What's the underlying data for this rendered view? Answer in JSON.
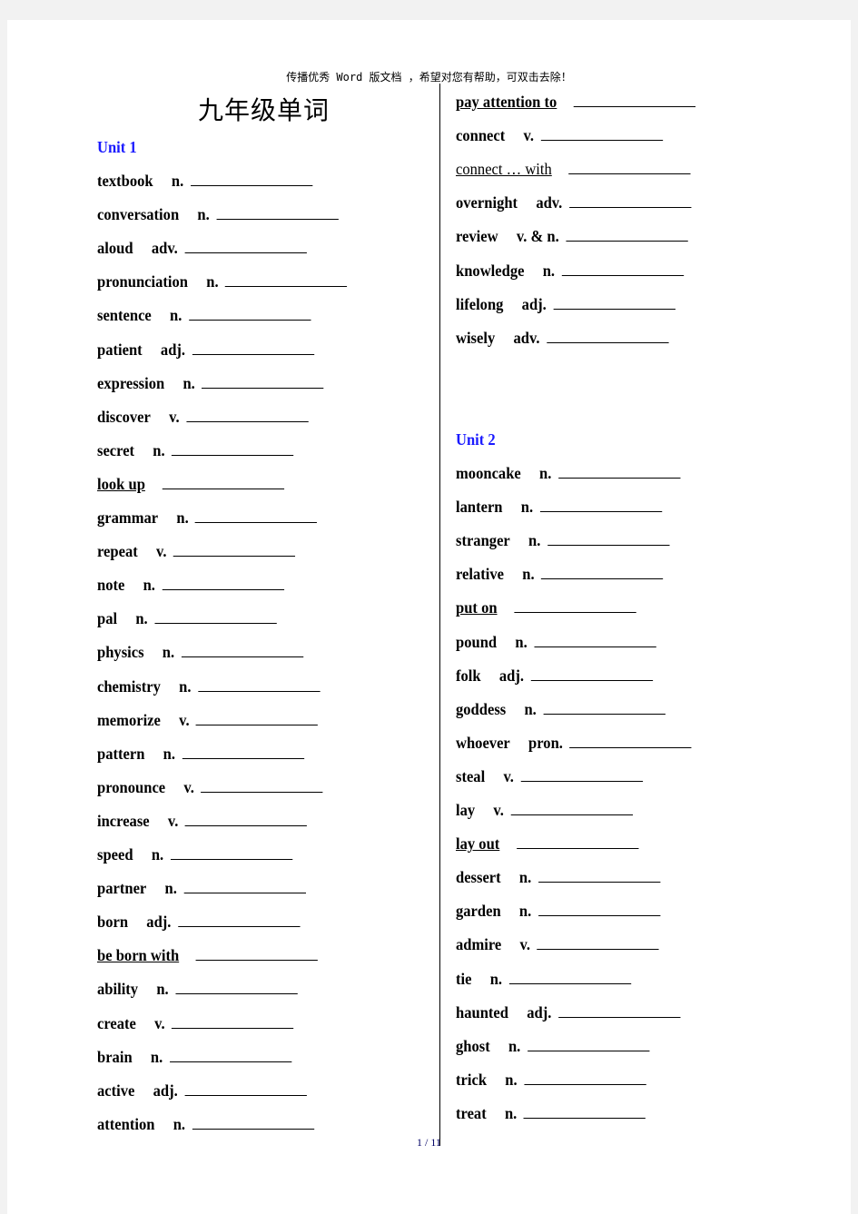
{
  "header_notice": "传播优秀 Word 版文档 ，希望对您有帮助，可双击去除！",
  "title": "九年级单词",
  "footer": "1 / 11",
  "colors": {
    "unit_heading": "#1a1aff"
  },
  "left_column": {
    "unit_heading": "Unit 1",
    "entries": [
      {
        "word": "textbook",
        "pos": "n."
      },
      {
        "word": "conversation",
        "pos": "n."
      },
      {
        "word": "aloud",
        "pos": "adv."
      },
      {
        "word": "pronunciation",
        "pos": "n."
      },
      {
        "word": "sentence",
        "pos": "n."
      },
      {
        "word": "patient",
        "pos": "adj."
      },
      {
        "word": "expression",
        "pos": "n."
      },
      {
        "word": "discover",
        "pos": "v."
      },
      {
        "word": "secret",
        "pos": "n."
      },
      {
        "word": "look up",
        "pos": "",
        "underlined": true
      },
      {
        "word": "grammar",
        "pos": "n."
      },
      {
        "word": "repeat",
        "pos": "v."
      },
      {
        "word": "note",
        "pos": "n."
      },
      {
        "word": "pal",
        "pos": "n."
      },
      {
        "word": "physics",
        "pos": "n."
      },
      {
        "word": "chemistry",
        "pos": "n."
      },
      {
        "word": "memorize",
        "pos": "v."
      },
      {
        "word": "pattern",
        "pos": "n."
      },
      {
        "word": "pronounce",
        "pos": "v."
      },
      {
        "word": "increase",
        "pos": "v."
      },
      {
        "word": "speed",
        "pos": "n."
      },
      {
        "word": "partner",
        "pos": "n."
      },
      {
        "word": "born",
        "pos": "adj."
      },
      {
        "word": "be born with",
        "pos": "",
        "underlined": true
      },
      {
        "word": "ability",
        "pos": "n."
      },
      {
        "word": "create",
        "pos": "v."
      },
      {
        "word": "brain",
        "pos": "n."
      },
      {
        "word": "active",
        "pos": "adj."
      },
      {
        "word": "attention",
        "pos": "n."
      }
    ]
  },
  "right_column": {
    "entries_top": [
      {
        "word": "pay attention to",
        "pos": "",
        "underlined": true
      },
      {
        "word": "connect",
        "pos": "v."
      },
      {
        "word": "connect … with",
        "pos": "",
        "underlined": true,
        "plain": true
      },
      {
        "word": "overnight",
        "pos": "adv."
      },
      {
        "word": "review",
        "pos": "v. & n."
      },
      {
        "word": "knowledge",
        "pos": "n."
      },
      {
        "word": "lifelong",
        "pos": "adj."
      },
      {
        "word": "wisely",
        "pos": "adv."
      }
    ],
    "unit_heading": "Unit 2",
    "entries": [
      {
        "word": "mooncake",
        "pos": "n."
      },
      {
        "word": "lantern",
        "pos": "n."
      },
      {
        "word": "stranger",
        "pos": "n."
      },
      {
        "word": "relative",
        "pos": "n."
      },
      {
        "word": "put on",
        "pos": "",
        "underlined": true
      },
      {
        "word": "pound",
        "pos": "n."
      },
      {
        "word": "folk",
        "pos": "adj."
      },
      {
        "word": "goddess",
        "pos": "n."
      },
      {
        "word": "whoever",
        "pos": "pron."
      },
      {
        "word": "steal",
        "pos": "v."
      },
      {
        "word": "lay",
        "pos": "v."
      },
      {
        "word": "lay out",
        "pos": "",
        "underlined": true
      },
      {
        "word": "dessert",
        "pos": "n."
      },
      {
        "word": "garden",
        "pos": "n."
      },
      {
        "word": "admire",
        "pos": "v."
      },
      {
        "word": "tie",
        "pos": "n."
      },
      {
        "word": "haunted",
        "pos": "adj."
      },
      {
        "word": "ghost",
        "pos": "n."
      },
      {
        "word": "trick",
        "pos": "n."
      },
      {
        "word": "treat",
        "pos": "n."
      }
    ]
  }
}
